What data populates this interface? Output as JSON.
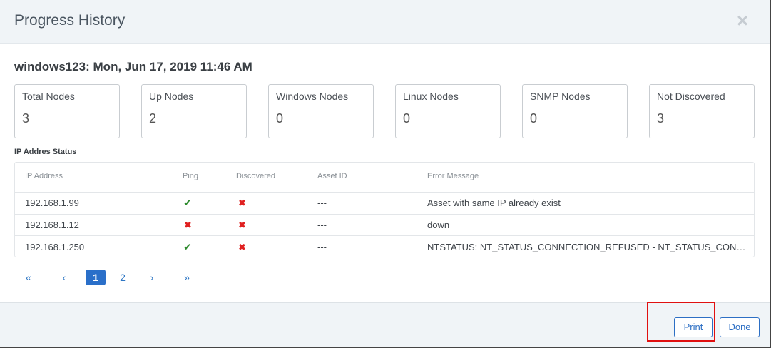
{
  "modal": {
    "title": "Progress History",
    "close_icon": "×"
  },
  "subtitle": "windows123: Mon, Jun 17, 2019 11:46 AM",
  "stats": [
    {
      "label": "Total Nodes",
      "value": "3"
    },
    {
      "label": "Up Nodes",
      "value": "2"
    },
    {
      "label": "Windows Nodes",
      "value": "0"
    },
    {
      "label": "Linux Nodes",
      "value": "0"
    },
    {
      "label": "SNMP Nodes",
      "value": "0"
    },
    {
      "label": "Not Discovered",
      "value": "3"
    }
  ],
  "section_label": "IP Addres Status",
  "table": {
    "headers": [
      "IP Address",
      "Ping",
      "Discovered",
      "Asset ID",
      "Error Message"
    ],
    "rows": [
      {
        "ip": "192.168.1.99",
        "ping": "ok",
        "discovered": "bad",
        "asset_id": "---",
        "error": "Asset with same IP already exist"
      },
      {
        "ip": "192.168.1.12",
        "ping": "bad",
        "discovered": "bad",
        "asset_id": "---",
        "error": "down"
      },
      {
        "ip": "192.168.1.250",
        "ping": "ok",
        "discovered": "bad",
        "asset_id": "---",
        "error": "NTSTATUS: NT_STATUS_CONNECTION_REFUSED - NT_STATUS_CONNECTION_REFUSED"
      }
    ]
  },
  "icons": {
    "ok": "✔",
    "bad": "✖",
    "ok_color": "#2e8b2e",
    "bad_color": "#e02020"
  },
  "pagination": {
    "first": "«",
    "prev": "‹",
    "pages": [
      "1",
      "2"
    ],
    "current": "1",
    "next": "›",
    "last": "»"
  },
  "footer": {
    "print_label": "Print",
    "done_label": "Done"
  }
}
